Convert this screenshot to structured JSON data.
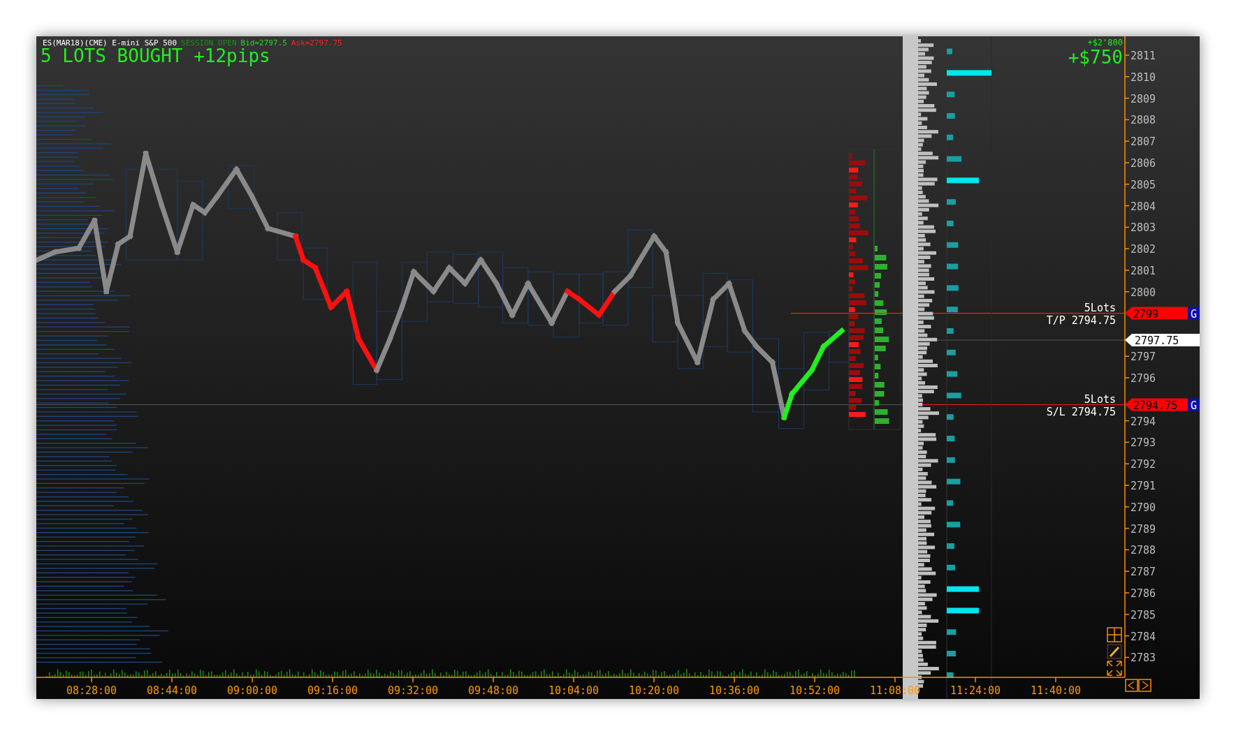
{
  "header": {
    "instrument": "ES(MAR18)(CME) E-mini S&P 500",
    "session": "SESSION OPEN",
    "bid": "Bid=2797.5",
    "ask": "Ask=2797.75",
    "status": "5 LOTS BOUGHT +12pips"
  },
  "pnl": {
    "total": "+$2'800",
    "open": "+$750"
  },
  "price_axis": [
    "2811",
    "2810",
    "2809",
    "2808",
    "2807",
    "2806",
    "2805",
    "2804",
    "2803",
    "2802",
    "2801",
    "2800",
    "2797",
    "2796",
    "2794",
    "2793",
    "2792",
    "2791",
    "2790",
    "2789",
    "2788",
    "2787",
    "2786",
    "2785",
    "2784",
    "2783"
  ],
  "time_axis": [
    "08:28:00",
    "08:44:00",
    "09:00:00",
    "09:16:00",
    "09:32:00",
    "09:48:00",
    "10:04:00",
    "10:20:00",
    "10:36:00",
    "10:52:00",
    "11:08:00",
    "11:24:00",
    "11:40:00"
  ],
  "orders": [
    {
      "kind": "take_profit",
      "lots": "5Lots",
      "label": "T/P 2794.75",
      "price": "2799",
      "badge": "G"
    },
    {
      "kind": "stop_loss",
      "lots": "5Lots",
      "label": "S/L 2794.75",
      "price": "2794.75",
      "badge": "G"
    }
  ],
  "last_price": "2797.75"
}
